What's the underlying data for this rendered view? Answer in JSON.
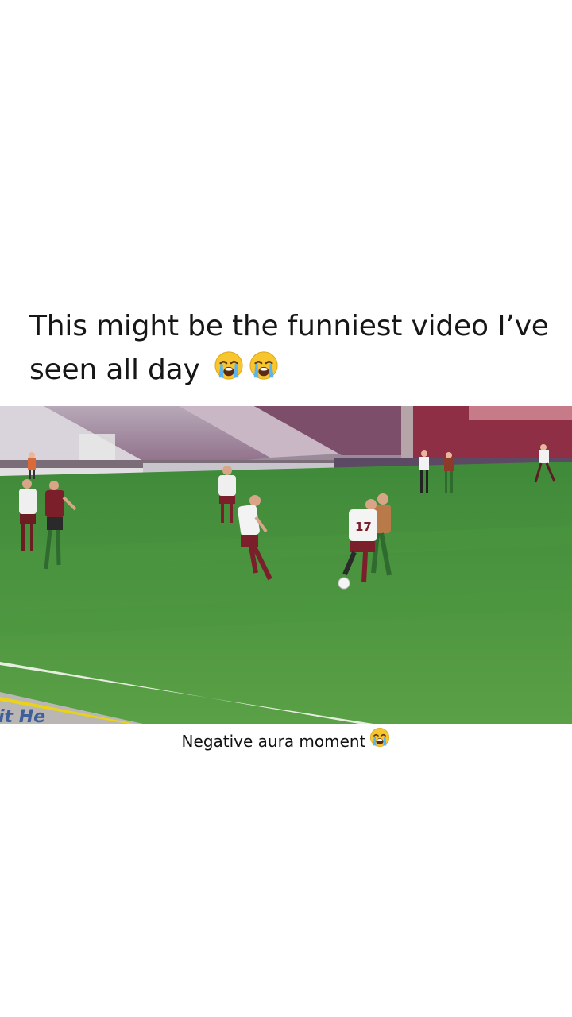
{
  "post": {
    "headline": "This might be the funniest video I’ve seen all day",
    "caption": "Negative aura moment"
  },
  "video": {
    "jersey_number": "17",
    "ad_board_text": "it He"
  },
  "icons": {
    "headline_emojis": [
      "loudly-crying-face",
      "loudly-crying-face"
    ],
    "caption_emoji": "loudly-crying-face"
  },
  "colors": {
    "pitch": "#4f9440",
    "seats": "#8a4f6e",
    "emoji_face": "#f7c52d",
    "tears": "#5ab3f2"
  }
}
